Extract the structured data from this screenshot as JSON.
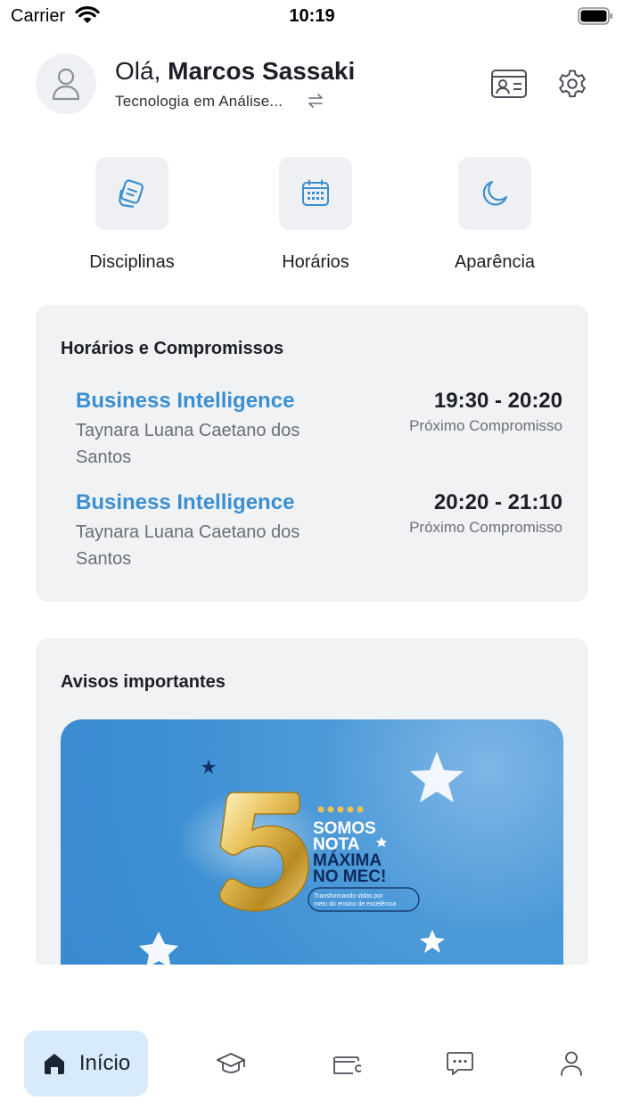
{
  "status_bar": {
    "carrier": "Carrier",
    "time": "10:19"
  },
  "header": {
    "greeting": "Olá,",
    "user_name": "Marcos Sassaki",
    "course": "Tecnologia em Análise..."
  },
  "quick_actions": [
    {
      "label": "Disciplinas",
      "icon": "notes-icon"
    },
    {
      "label": "Horários",
      "icon": "calendar-icon"
    },
    {
      "label": "Aparência",
      "icon": "moon-icon"
    }
  ],
  "schedule": {
    "title": "Horários e Compromissos",
    "items": [
      {
        "subject": "Business Intelligence",
        "professor": "Taynara Luana Caetano dos Santos",
        "time": "19:30 - 20:20",
        "status": "Próximo Compromisso"
      },
      {
        "subject": "Business Intelligence",
        "professor": "Taynara Luana Caetano dos Santos",
        "time": "20:20 - 21:10",
        "status": "Próximo Compromisso"
      }
    ]
  },
  "notices": {
    "title": "Avisos importantes",
    "banner": {
      "number": "5",
      "line1": "SOMOS",
      "line2": "NOTA",
      "line3": "MÁXIMA",
      "line4": "NO MEC!",
      "tagline1": "Transformando vidas por",
      "tagline2": "meio do ensino de excelência"
    }
  },
  "bottom_nav": {
    "home_label": "Início",
    "items": [
      "home-icon",
      "graduation-cap-icon",
      "wallet-icon",
      "chat-icon",
      "profile-icon"
    ]
  },
  "colors": {
    "accent": "#3a8fd1",
    "panel": "#f1f2f4",
    "home_pill": "#d8ebfb"
  }
}
